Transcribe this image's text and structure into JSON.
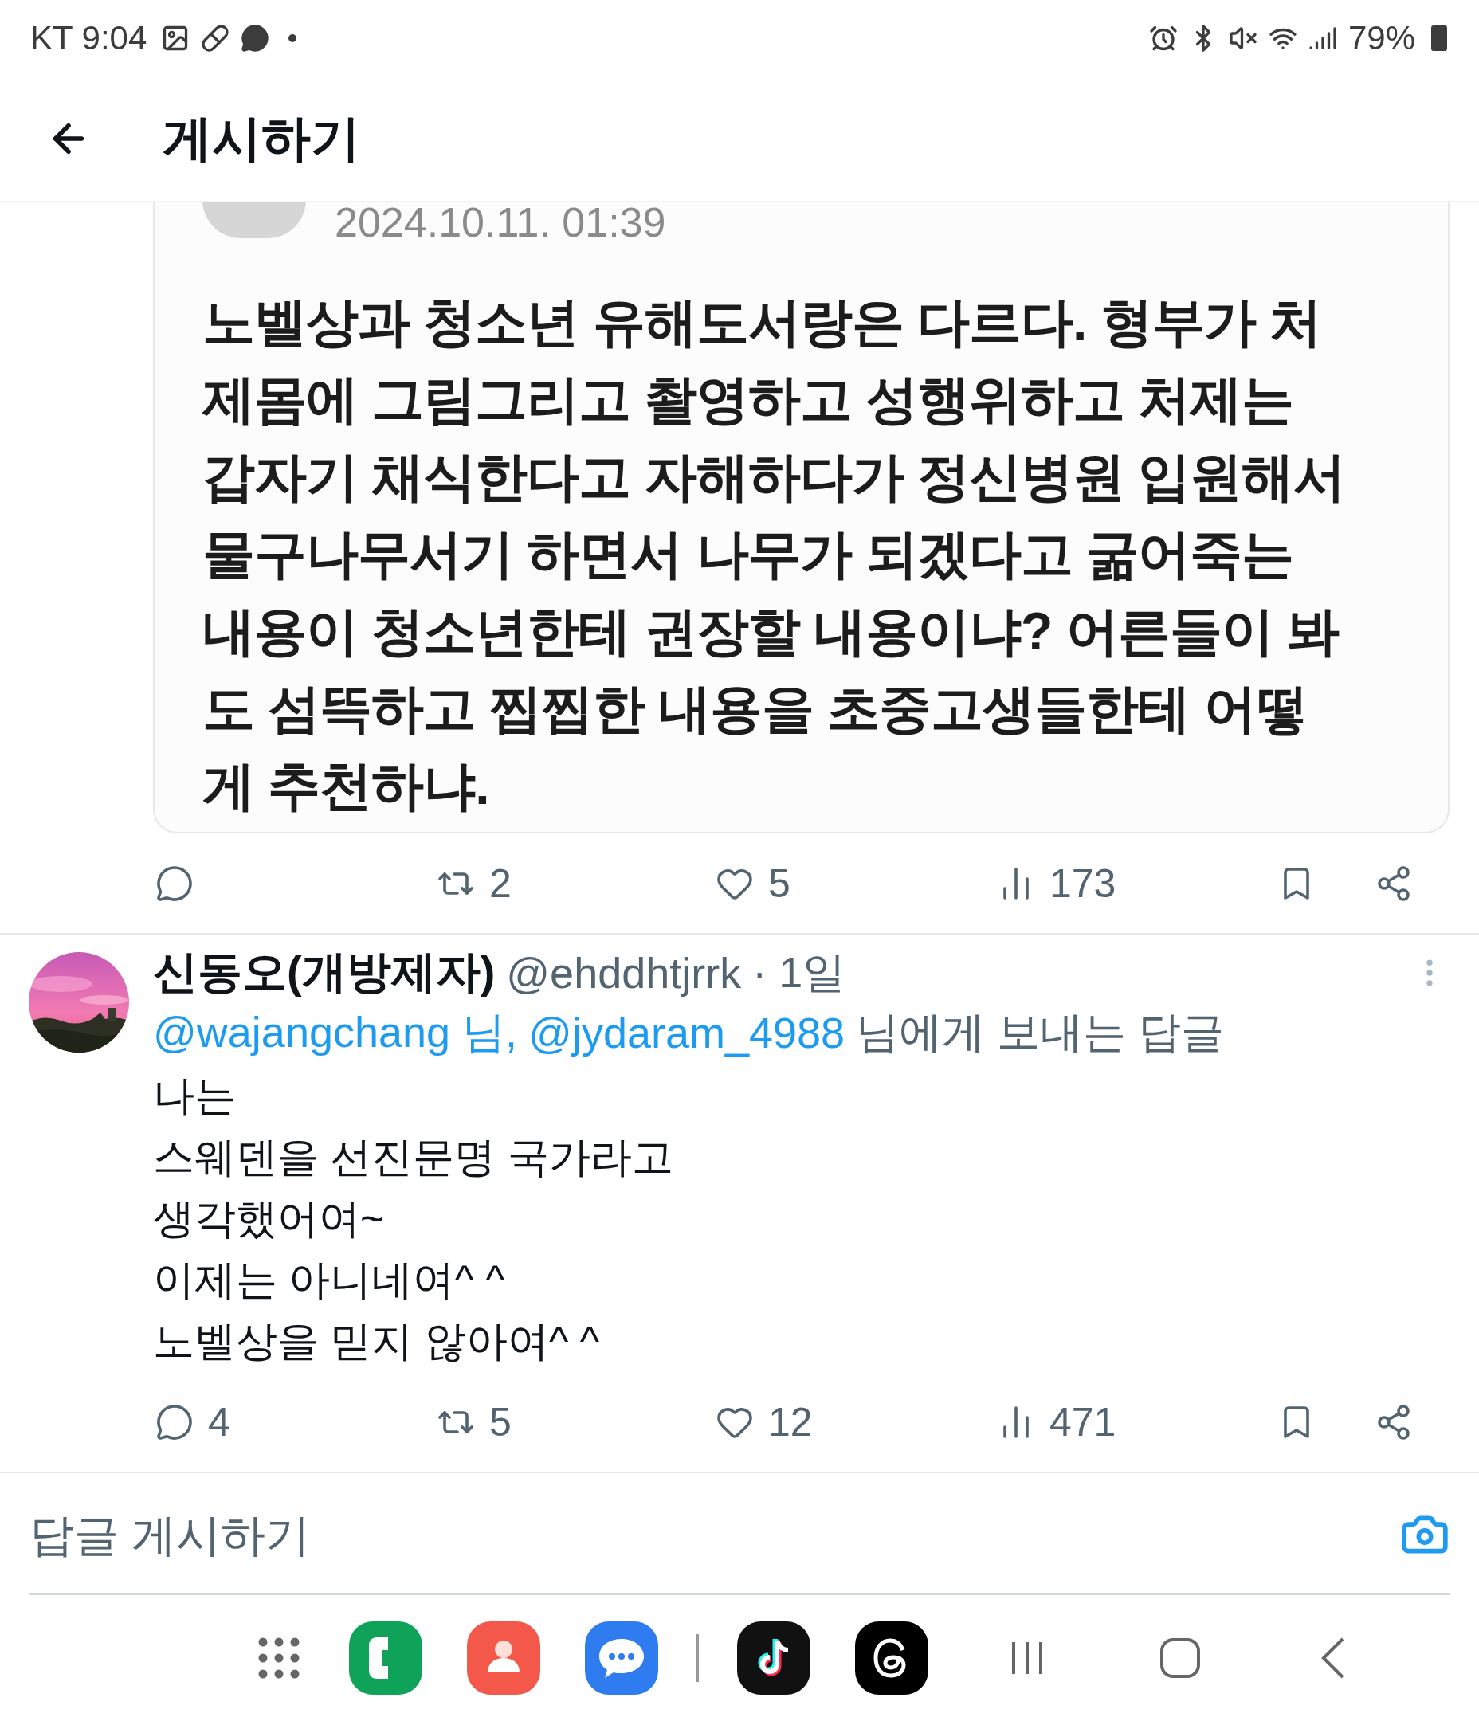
{
  "status_bar": {
    "carrier_time": "KT 9:04",
    "battery": "79%"
  },
  "header": {
    "title": "게시하기"
  },
  "quoted_image": {
    "date": "2024.10.11. 01:39",
    "lines": [
      "노벨상과 청소년 유해도서랑은 다르다. 형부가 처",
      "제몸에 그림그리고 촬영하고 성행위하고 처제는",
      "갑자기 채식한다고 자해하다가 정신병원 입원해서",
      "물구나무서기 하면서 나무가 되겠다고 굶어죽는",
      "내용이 청소년한테 권장할 내용이냐? 어른들이 봐",
      "도 섬뜩하고 찝찝한 내용을 초중고생들한테 어떻",
      "게 추천하냐."
    ]
  },
  "quote_actions": [
    {
      "kind": "reply"
    },
    {
      "kind": "repost",
      "count": "2"
    },
    {
      "kind": "like",
      "count": "5"
    },
    {
      "kind": "views",
      "count": "173"
    },
    {
      "kind": "bookmark"
    },
    {
      "kind": "share"
    }
  ],
  "reply_post": {
    "name": "신동오(개방제자)",
    "handle": "@ehddhtjrrk",
    "time": "· 1일",
    "mentions": [
      "@wajangchang 님,",
      "@jydaram_4988"
    ],
    "replying_suffix": "님에게 보내는 답글",
    "body": [
      "나는",
      "스웨덴을 선진문명 국가라고",
      "생각했어여~",
      "이제는 아니네여^ ^",
      "노벨상을 믿지 않아여^ ^"
    ],
    "actions": [
      {
        "kind": "reply",
        "count": "4"
      },
      {
        "kind": "repost",
        "count": "5"
      },
      {
        "kind": "like",
        "count": "12"
      },
      {
        "kind": "views",
        "count": "471"
      },
      {
        "kind": "bookmark"
      },
      {
        "kind": "share"
      }
    ]
  },
  "composer": {
    "placeholder": "답글 게시하기"
  },
  "dock": [
    {
      "kind": "apps"
    },
    {
      "kind": "phone"
    },
    {
      "kind": "contacts"
    },
    {
      "kind": "messages"
    },
    {
      "kind": "divider"
    },
    {
      "kind": "tiktok"
    },
    {
      "kind": "threads"
    },
    {
      "kind": "recents"
    },
    {
      "kind": "home"
    },
    {
      "kind": "back"
    }
  ]
}
